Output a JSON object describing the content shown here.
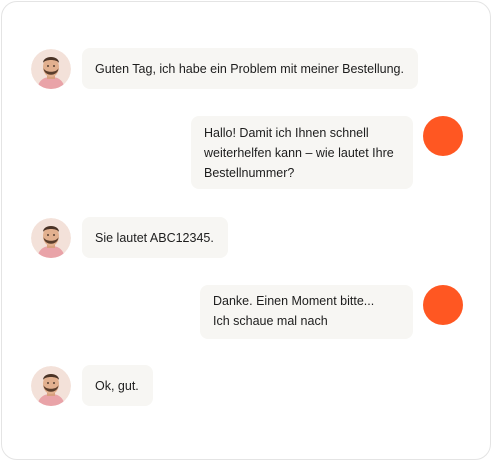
{
  "chat": {
    "messages": [
      {
        "sender": "user",
        "text": "Guten Tag, ich habe ein Problem mit meiner Bestellung."
      },
      {
        "sender": "agent",
        "text": "Hallo! Damit ich Ihnen schnell\nweiterhelfen kann – wie lautet Ihre\nBestellnummer?"
      },
      {
        "sender": "user",
        "text": "Sie lautet ABC12345."
      },
      {
        "sender": "agent",
        "text": "Danke. Einen Moment bitte...\nIch schaue mal nach"
      },
      {
        "sender": "user",
        "text": "Ok, gut."
      }
    ]
  },
  "colors": {
    "accent": "#ff5722",
    "bubble_bg": "#f7f6f3",
    "text": "#1d1d1d"
  },
  "icons": {
    "user_avatar": "user-avatar-icon",
    "agent_avatar": "agent-avatar-icon"
  }
}
